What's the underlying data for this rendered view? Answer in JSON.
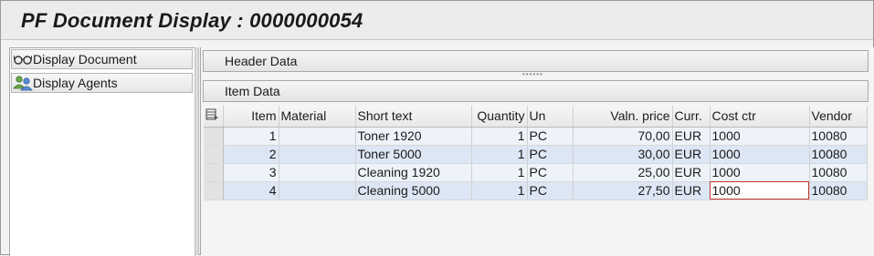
{
  "window": {
    "title": "PF Document Display : 0000000054"
  },
  "nav": {
    "items": [
      {
        "label": "Display Document",
        "icon": "glasses-icon"
      },
      {
        "label": "Display Agents",
        "icon": "agents-icon"
      }
    ]
  },
  "panels": {
    "header": "Header Data",
    "item": "Item Data"
  },
  "table": {
    "columns": [
      "Item",
      "Material",
      "Short text",
      "Quantity",
      "Un",
      "Valn. price",
      "Curr.",
      "Cost ctr",
      "Vendor"
    ],
    "rows": [
      {
        "item": "1",
        "material": "",
        "short_text": "Toner 1920",
        "quantity": "1",
        "un": "PC",
        "price": "70,00",
        "curr": "EUR",
        "cost_ctr": "1000",
        "vendor": "10080"
      },
      {
        "item": "2",
        "material": "",
        "short_text": "Toner 5000",
        "quantity": "1",
        "un": "PC",
        "price": "30,00",
        "curr": "EUR",
        "cost_ctr": "1000",
        "vendor": "10080"
      },
      {
        "item": "3",
        "material": "",
        "short_text": "Cleaning 1920",
        "quantity": "1",
        "un": "PC",
        "price": "25,00",
        "curr": "EUR",
        "cost_ctr": "1000",
        "vendor": "10080"
      },
      {
        "item": "4",
        "material": "",
        "short_text": "Cleaning 5000",
        "quantity": "1",
        "un": "PC",
        "price": "27,50",
        "curr": "EUR",
        "cost_ctr": "1000",
        "vendor": "10080"
      }
    ]
  },
  "colors": {
    "row_odd": "#eef3fa",
    "row_even": "#dce6f4",
    "focus_border": "#c0392b"
  }
}
